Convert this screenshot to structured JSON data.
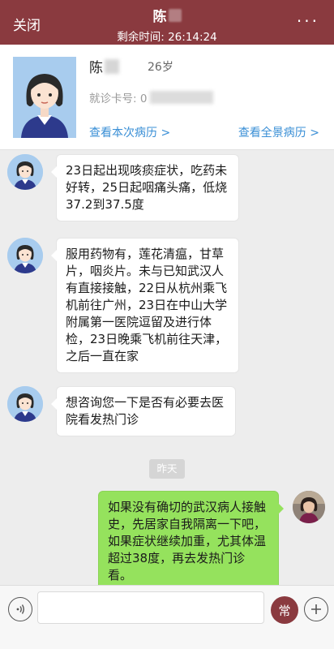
{
  "header": {
    "close_label": "关闭",
    "title_name": "陈",
    "timer_label": "剩余时间: 26:14:24",
    "more_label": "···"
  },
  "patient": {
    "name": "陈",
    "age": "26岁",
    "card_label": "就诊卡号: 0",
    "link_current": "查看本次病历 >",
    "link_full": "查看全景病历 >"
  },
  "messages": [
    {
      "from": "patient",
      "text": "23日起出现咳痰症状，吃药未好转，25日起咽痛头痛，低烧37.2到37.5度"
    },
    {
      "from": "patient",
      "text": "服用药物有，莲花清瘟，甘草片，咽炎片。未与已知武汉人有直接接触，22日从杭州乘飞机前往广州，23日在中山大学附属第一医院逗留及进行体检，23日晚乘飞机前往天津，之后一直在家"
    },
    {
      "from": "patient",
      "text": "想咨询您一下是否有必要去医院看发热门诊"
    },
    {
      "from": "doctor",
      "text": "如果没有确切的武汉病人接触史，先居家自我隔离一下吧，如果症状继续加重，尤其体温超过38度，再去发热门诊看。"
    }
  ],
  "date_divider": "昨天",
  "inputbar": {
    "common_label": "常"
  },
  "colors": {
    "header_bg": "#8a3a3f",
    "link": "#3a8fd6",
    "doctor_bubble": "#95e25d",
    "avatar_bg": "#a8ccee"
  },
  "icons": {
    "voice": "voice-icon",
    "plus": "plus-icon",
    "more": "more-icon"
  }
}
